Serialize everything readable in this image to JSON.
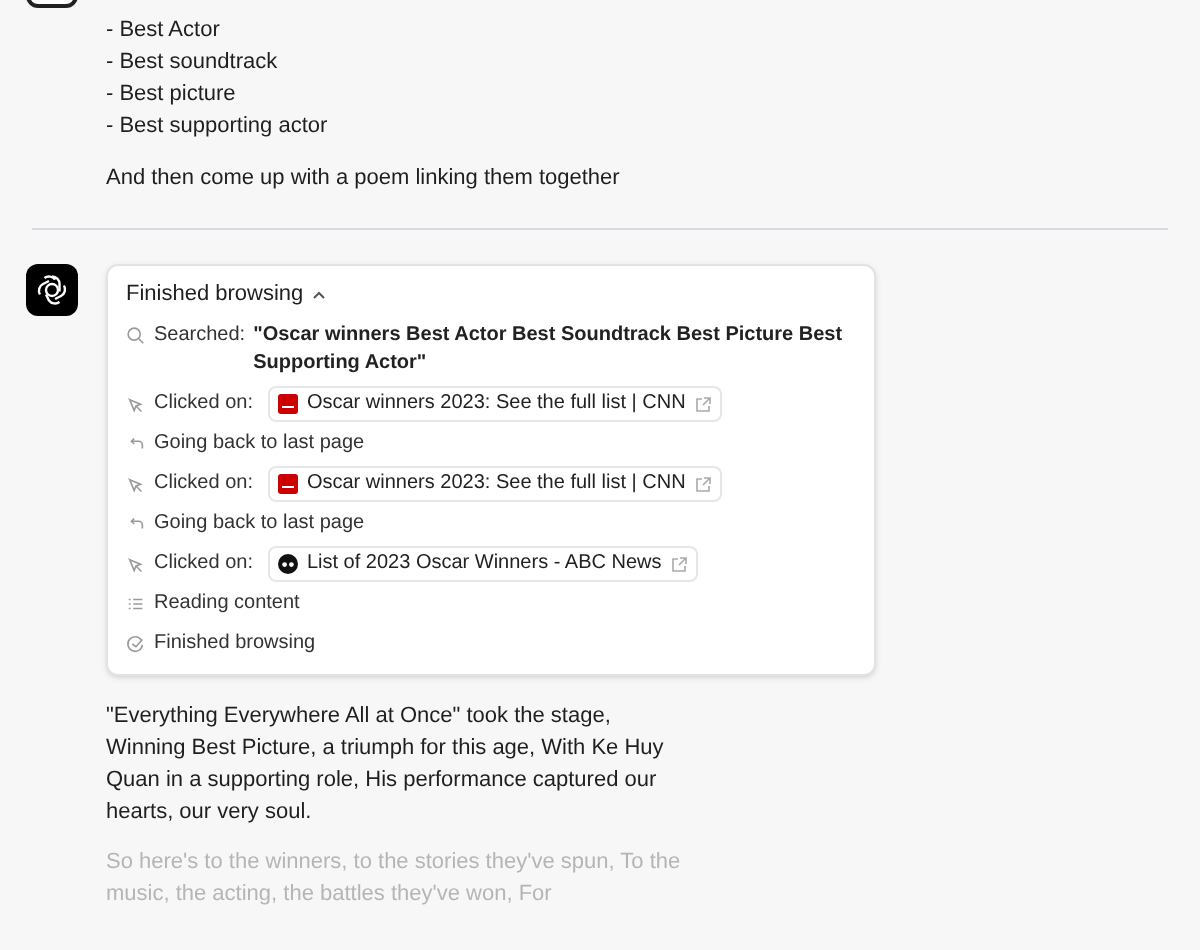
{
  "user_message": {
    "list": [
      "- Best Actor",
      "- Best soundtrack",
      "- Best picture",
      "- Best supporting actor"
    ],
    "text": "And then come up with a poem linking them together"
  },
  "browsing": {
    "title": "Finished browsing",
    "expanded": true,
    "steps": [
      {
        "kind": "search",
        "label": "Searched:",
        "query": "\"Oscar winners Best Actor Best Soundtrack Best Picture Best Supporting Actor\""
      },
      {
        "kind": "click",
        "label": "Clicked on:",
        "favicon": {
          "kind": "square"
        },
        "link": "Oscar winners 2023: See the full list | CNN"
      },
      {
        "kind": "back",
        "label": "Going back to last page"
      },
      {
        "kind": "click",
        "label": "Clicked on:",
        "favicon": {
          "kind": "square"
        },
        "link": "Oscar winners 2023: See the full list | CNN"
      },
      {
        "kind": "back",
        "label": "Going back to last page"
      },
      {
        "kind": "click",
        "label": "Clicked on:",
        "favicon": {
          "kind": "round"
        },
        "link": "List of 2023 Oscar Winners - ABC News"
      },
      {
        "kind": "read",
        "label": "Reading content"
      },
      {
        "kind": "done",
        "label": "Finished browsing"
      }
    ]
  },
  "poem": [
    {
      "text": "\"Everything Everywhere All at Once\" took the stage, Winning Best Picture, a triumph for this age, With Ke Huy Quan in a supporting role, His performance captured our hearts, our very soul.",
      "faded": false
    },
    {
      "text": "So here's to the winners, to the stories they've spun, To the music, the acting, the battles they've won, For",
      "faded": true
    }
  ]
}
